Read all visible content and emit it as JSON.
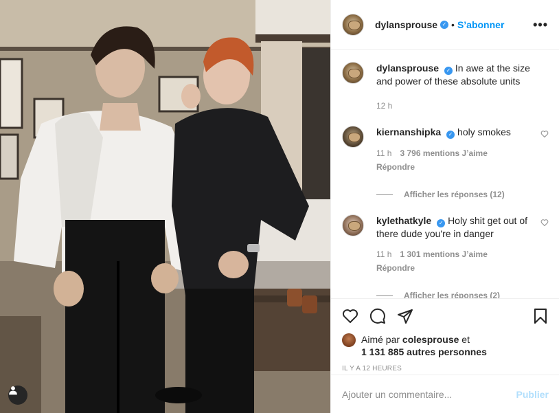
{
  "post": {
    "author": "dylansprouse",
    "follow_label": "S’abonner",
    "separator": "•",
    "more_label": "•••",
    "caption": "In awe at the size and power of these absolute units",
    "caption_time": "12 h"
  },
  "comments": [
    {
      "user": "kiernanshipka",
      "text": "holy smokes",
      "time": "11 h",
      "likes": "3 796 mentions J’aime",
      "reply_label": "Répondre",
      "view_replies": "Afficher les réponses (12)"
    },
    {
      "user": "kylethatkyle",
      "text": "Holy shit get out of there dude you're in danger",
      "time": "11 h",
      "likes": "1 301 mentions J’aime",
      "reply_label": "Répondre",
      "view_replies": "Afficher les réponses (2)"
    }
  ],
  "likes": {
    "prefix": "Aimé par",
    "user": "colesprouse",
    "conj": "et",
    "others": "1 131 885 autres personnes"
  },
  "timestamp": "IL Y A 12 HEURES",
  "add_comment": {
    "placeholder": "Ajouter un commentaire...",
    "publish_label": "Publier"
  },
  "icons": {
    "like": "heart-icon",
    "comment": "comment-icon",
    "share": "share-icon",
    "save": "bookmark-icon",
    "tag": "user-tag-icon"
  },
  "colors": {
    "accent": "#0095f6",
    "verified": "#3897f0",
    "muted": "#8e8e8e",
    "publish_disabled": "#b2dffc"
  }
}
